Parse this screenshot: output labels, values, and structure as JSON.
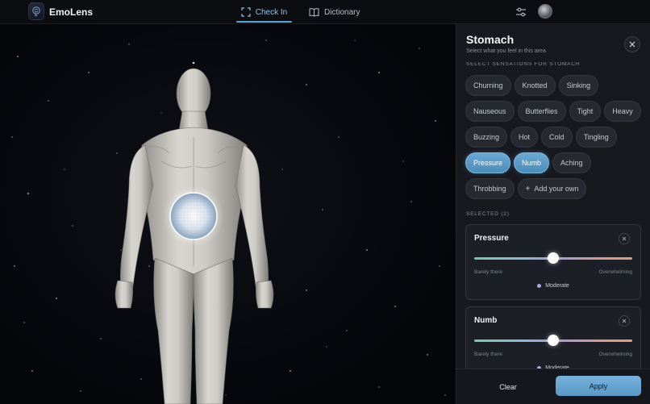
{
  "app": {
    "name": "EmoLens"
  },
  "nav": {
    "tabs": [
      {
        "label": "Check In",
        "icon": "scan-icon",
        "active": true
      },
      {
        "label": "Dictionary",
        "icon": "book-icon",
        "active": false
      }
    ]
  },
  "scene": {
    "selected_region": "Stomach"
  },
  "panel": {
    "title": "Stomach",
    "subtitle": "Select what you feel in this area",
    "sensations_label": "SELECT SENSATIONS FOR STOMACH",
    "sensations": [
      {
        "label": "Churning",
        "selected": false
      },
      {
        "label": "Knotted",
        "selected": false
      },
      {
        "label": "Sinking",
        "selected": false
      },
      {
        "label": "Nauseous",
        "selected": false
      },
      {
        "label": "Butterflies",
        "selected": false
      },
      {
        "label": "Tight",
        "selected": false
      },
      {
        "label": "Heavy",
        "selected": false
      },
      {
        "label": "Buzzing",
        "selected": false
      },
      {
        "label": "Hot",
        "selected": false
      },
      {
        "label": "Cold",
        "selected": false
      },
      {
        "label": "Tingling",
        "selected": false
      },
      {
        "label": "Pressure",
        "selected": true
      },
      {
        "label": "Numb",
        "selected": true
      },
      {
        "label": "Aching",
        "selected": false
      },
      {
        "label": "Throbbing",
        "selected": false
      }
    ],
    "add_own_label": "Add your own",
    "selected_label": "SELECTED (2)",
    "selected": [
      {
        "name": "Pressure",
        "min_label": "Barely there",
        "max_label": "Overwhelming",
        "intensity": 0.5,
        "level_label": "Moderate"
      },
      {
        "name": "Numb",
        "min_label": "Barely there",
        "max_label": "Overwhelming",
        "intensity": 0.5,
        "level_label": "Moderate"
      }
    ],
    "footer": {
      "clear_label": "Clear",
      "apply_label": "Apply"
    }
  },
  "colors": {
    "accent": "#5aa6d6",
    "chip_selected": "#5a9ac6",
    "background": "#07080b"
  }
}
